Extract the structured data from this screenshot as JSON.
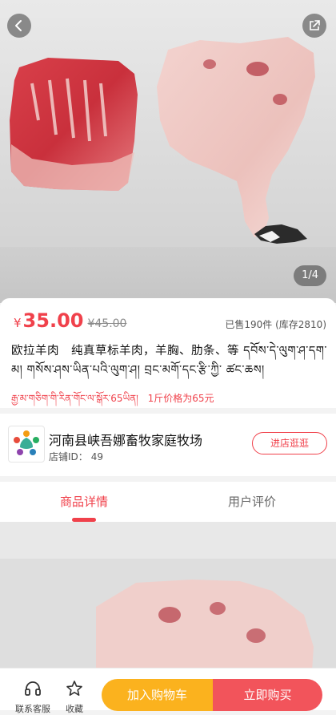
{
  "gallery": {
    "counter": "1/4",
    "back_icon": "chevron-left-icon",
    "share_icon": "share-icon"
  },
  "product": {
    "price_symbol": "¥",
    "price": "35.00",
    "original_price": "¥45.00",
    "sales": "已售190件 (库存2810)",
    "title": "欧拉羊肉　纯真草标羊肉，羊胸、肋条、等 དབོས་དེ་ལུག་ཤ་དག་མ། གསོས་ཤས་ཡིན་པའི་ལུག་ཤ། བྲང་མགོ་དང་རྩི་ཀྱི་ ཚང་ཆས།",
    "promo_tibetan": "རྒྱ་མ་གཅིག་གི་རིན་གོང་ལ་སྒོར་65ཡིན།",
    "promo_chinese": "1斤价格为65元",
    "accent_color": "#f0414b"
  },
  "shop": {
    "name": "河南县峡吾娜畜牧家庭牧场",
    "id_label": "店铺ID：",
    "id_value": "49",
    "visit_label": "进店逛逛"
  },
  "tabs": [
    {
      "label": "商品详情",
      "active": true
    },
    {
      "label": "用户评价",
      "active": false
    }
  ],
  "bottom_bar": {
    "service_label": "联系客服",
    "service_icon": "headphones-icon",
    "favorite_label": "收藏",
    "favorite_icon": "star-icon",
    "cart_label": "加入购物车",
    "buy_label": "立即购买",
    "cart_color": "#fbb21e",
    "buy_color": "#f2545b"
  }
}
